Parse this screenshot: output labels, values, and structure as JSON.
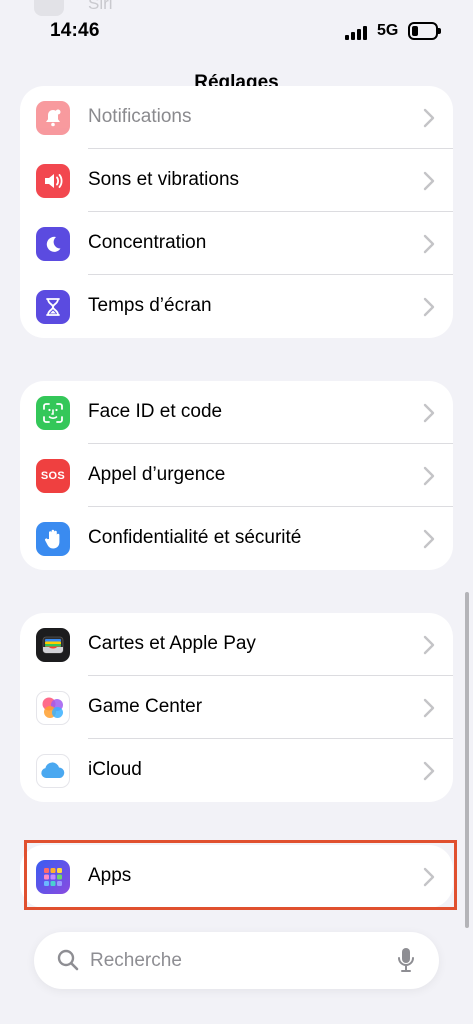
{
  "status": {
    "time": "14:46",
    "network": "5G"
  },
  "header": {
    "title": "Réglages",
    "ghost_label": "Siri"
  },
  "groups": [
    {
      "items": [
        {
          "label": "Notifications",
          "icon": "bell-icon",
          "color": "#f2474f"
        },
        {
          "label": "Sons et vibrations",
          "icon": "speaker-icon",
          "color": "#f2474f"
        },
        {
          "label": "Concentration",
          "icon": "moon-icon",
          "color": "#5b4be0"
        },
        {
          "label": "Temps d’écran",
          "icon": "hourglass-icon",
          "color": "#5b4be0"
        }
      ]
    },
    {
      "items": [
        {
          "label": "Face ID et code",
          "icon": "face-id-icon",
          "color": "#34c759"
        },
        {
          "label": "Appel d’urgence",
          "icon": "sos-icon",
          "icon_text": "SOS",
          "color": "#ef4040"
        },
        {
          "label": "Confidentialité et sécurité",
          "icon": "hand-icon",
          "color": "#3a8bf0"
        }
      ]
    },
    {
      "items": [
        {
          "label": "Cartes et Apple Pay",
          "icon": "wallet-icon",
          "color": "#1c1c1e"
        },
        {
          "label": "Game Center",
          "icon": "game-center-icon",
          "color": "#ffffff"
        },
        {
          "label": "iCloud",
          "icon": "cloud-icon",
          "color": "#ffffff"
        }
      ]
    },
    {
      "items": [
        {
          "label": "Apps",
          "icon": "apps-grid-icon",
          "color": "#5b4be0"
        }
      ]
    }
  ],
  "search": {
    "placeholder": "Recherche"
  },
  "colors": {
    "highlight": "#e0502f",
    "background": "#f2f2f7"
  }
}
